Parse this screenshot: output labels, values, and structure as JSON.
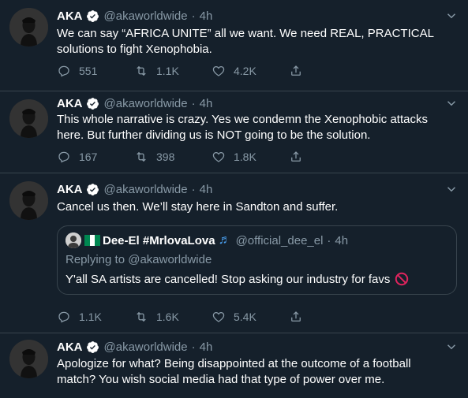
{
  "colors": {
    "background": "#15202b",
    "border": "#38444d",
    "secondary_text": "#8899a6",
    "verified_badge": "#ffffff",
    "nigeria_green": "#008751",
    "no_entry_red": "#e0245e",
    "music_note_blue": "#4ba3f5"
  },
  "tweets": [
    {
      "name": "AKA",
      "handle": "@akaworldwide",
      "separator": "·",
      "time": "4h",
      "lines": [
        "We can say “AFRICA UNITE” all we want. We need REAL, PRACTICAL",
        "solutions to fight Xenophobia."
      ],
      "replies": "551",
      "retweets": "1.1K",
      "likes": "4.2K"
    },
    {
      "name": "AKA",
      "handle": "@akaworldwide",
      "separator": "·",
      "time": "4h",
      "lines": [
        "This whole narrative is crazy. Yes we condemn the Xenophobic attacks",
        "here. But further dividing us is NOT going to be the solution."
      ],
      "replies": "167",
      "retweets": "398",
      "likes": "1.8K"
    },
    {
      "name": "AKA",
      "handle": "@akaworldwide",
      "separator": "·",
      "time": "4h",
      "lines": [
        "Cancel us then. We’ll stay here in Sandton and suffer."
      ],
      "quote": {
        "name": "Dee-El #MrlovaLova",
        "name_suffix_icon": "music-notes-icon",
        "handle": "@official_dee_el",
        "separator": "·",
        "time": "4h",
        "reply_to": "Replying to @akaworldwide",
        "text": "Y'all SA artists are cancelled!  Stop asking our industry for favs",
        "flag_icon": "nigeria-flag-icon",
        "trailing_icon": "no-entry-icon"
      },
      "replies": "1.1K",
      "retweets": "1.6K",
      "likes": "5.4K"
    },
    {
      "name": "AKA",
      "handle": "@akaworldwide",
      "separator": "·",
      "time": "4h",
      "lines": [
        "Apologize for what? Being disappointed at the outcome of a football",
        "match? You wish social media had that type of power over me."
      ]
    }
  ]
}
